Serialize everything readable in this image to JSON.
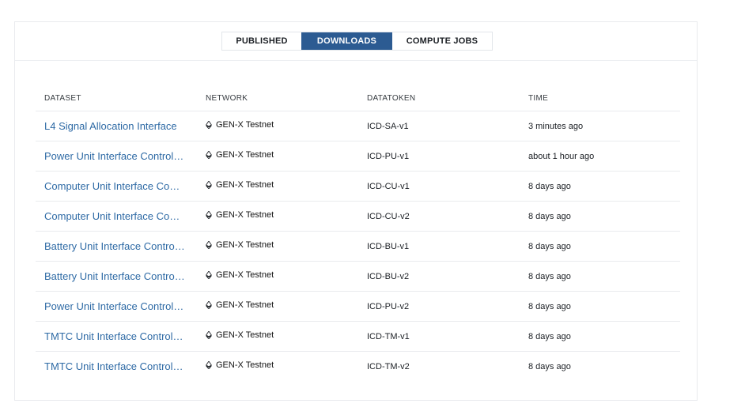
{
  "tabs": [
    {
      "label": "PUBLISHED",
      "active": false
    },
    {
      "label": "DOWNLOADS",
      "active": true
    },
    {
      "label": "COMPUTE JOBS",
      "active": false
    }
  ],
  "table": {
    "headers": [
      "DATASET",
      "NETWORK",
      "DATATOKEN",
      "TIME"
    ],
    "rows": [
      {
        "dataset": "L4 Signal Allocation Interface",
        "network": "GEN-X Testnet",
        "datatoken": "ICD-SA-v1",
        "time": "3 minutes ago"
      },
      {
        "dataset": "Power Unit Interface Control Document",
        "network": "GEN-X Testnet",
        "datatoken": "ICD-PU-v1",
        "time": "about 1 hour ago"
      },
      {
        "dataset": "Computer Unit Interface Control Document",
        "network": "GEN-X Testnet",
        "datatoken": "ICD-CU-v1",
        "time": "8 days ago"
      },
      {
        "dataset": "Computer Unit Interface Control Document",
        "network": "GEN-X Testnet",
        "datatoken": "ICD-CU-v2",
        "time": "8 days ago"
      },
      {
        "dataset": "Battery Unit Interface Control Document",
        "network": "GEN-X Testnet",
        "datatoken": "ICD-BU-v1",
        "time": "8 days ago"
      },
      {
        "dataset": "Battery Unit Interface Control Document",
        "network": "GEN-X Testnet",
        "datatoken": "ICD-BU-v2",
        "time": "8 days ago"
      },
      {
        "dataset": "Power Unit Interface Control Document",
        "network": "GEN-X Testnet",
        "datatoken": "ICD-PU-v2",
        "time": "8 days ago"
      },
      {
        "dataset": "TMTC Unit Interface Control Document",
        "network": "GEN-X Testnet",
        "datatoken": "ICD-TM-v1",
        "time": "8 days ago"
      },
      {
        "dataset": "TMTC Unit Interface Control Document",
        "network": "GEN-X Testnet",
        "datatoken": "ICD-TM-v2",
        "time": "8 days ago"
      }
    ]
  },
  "icons": {
    "network": "ethereum-icon"
  },
  "colors": {
    "accent": "#2c5b92",
    "link": "#2e6aa5"
  }
}
